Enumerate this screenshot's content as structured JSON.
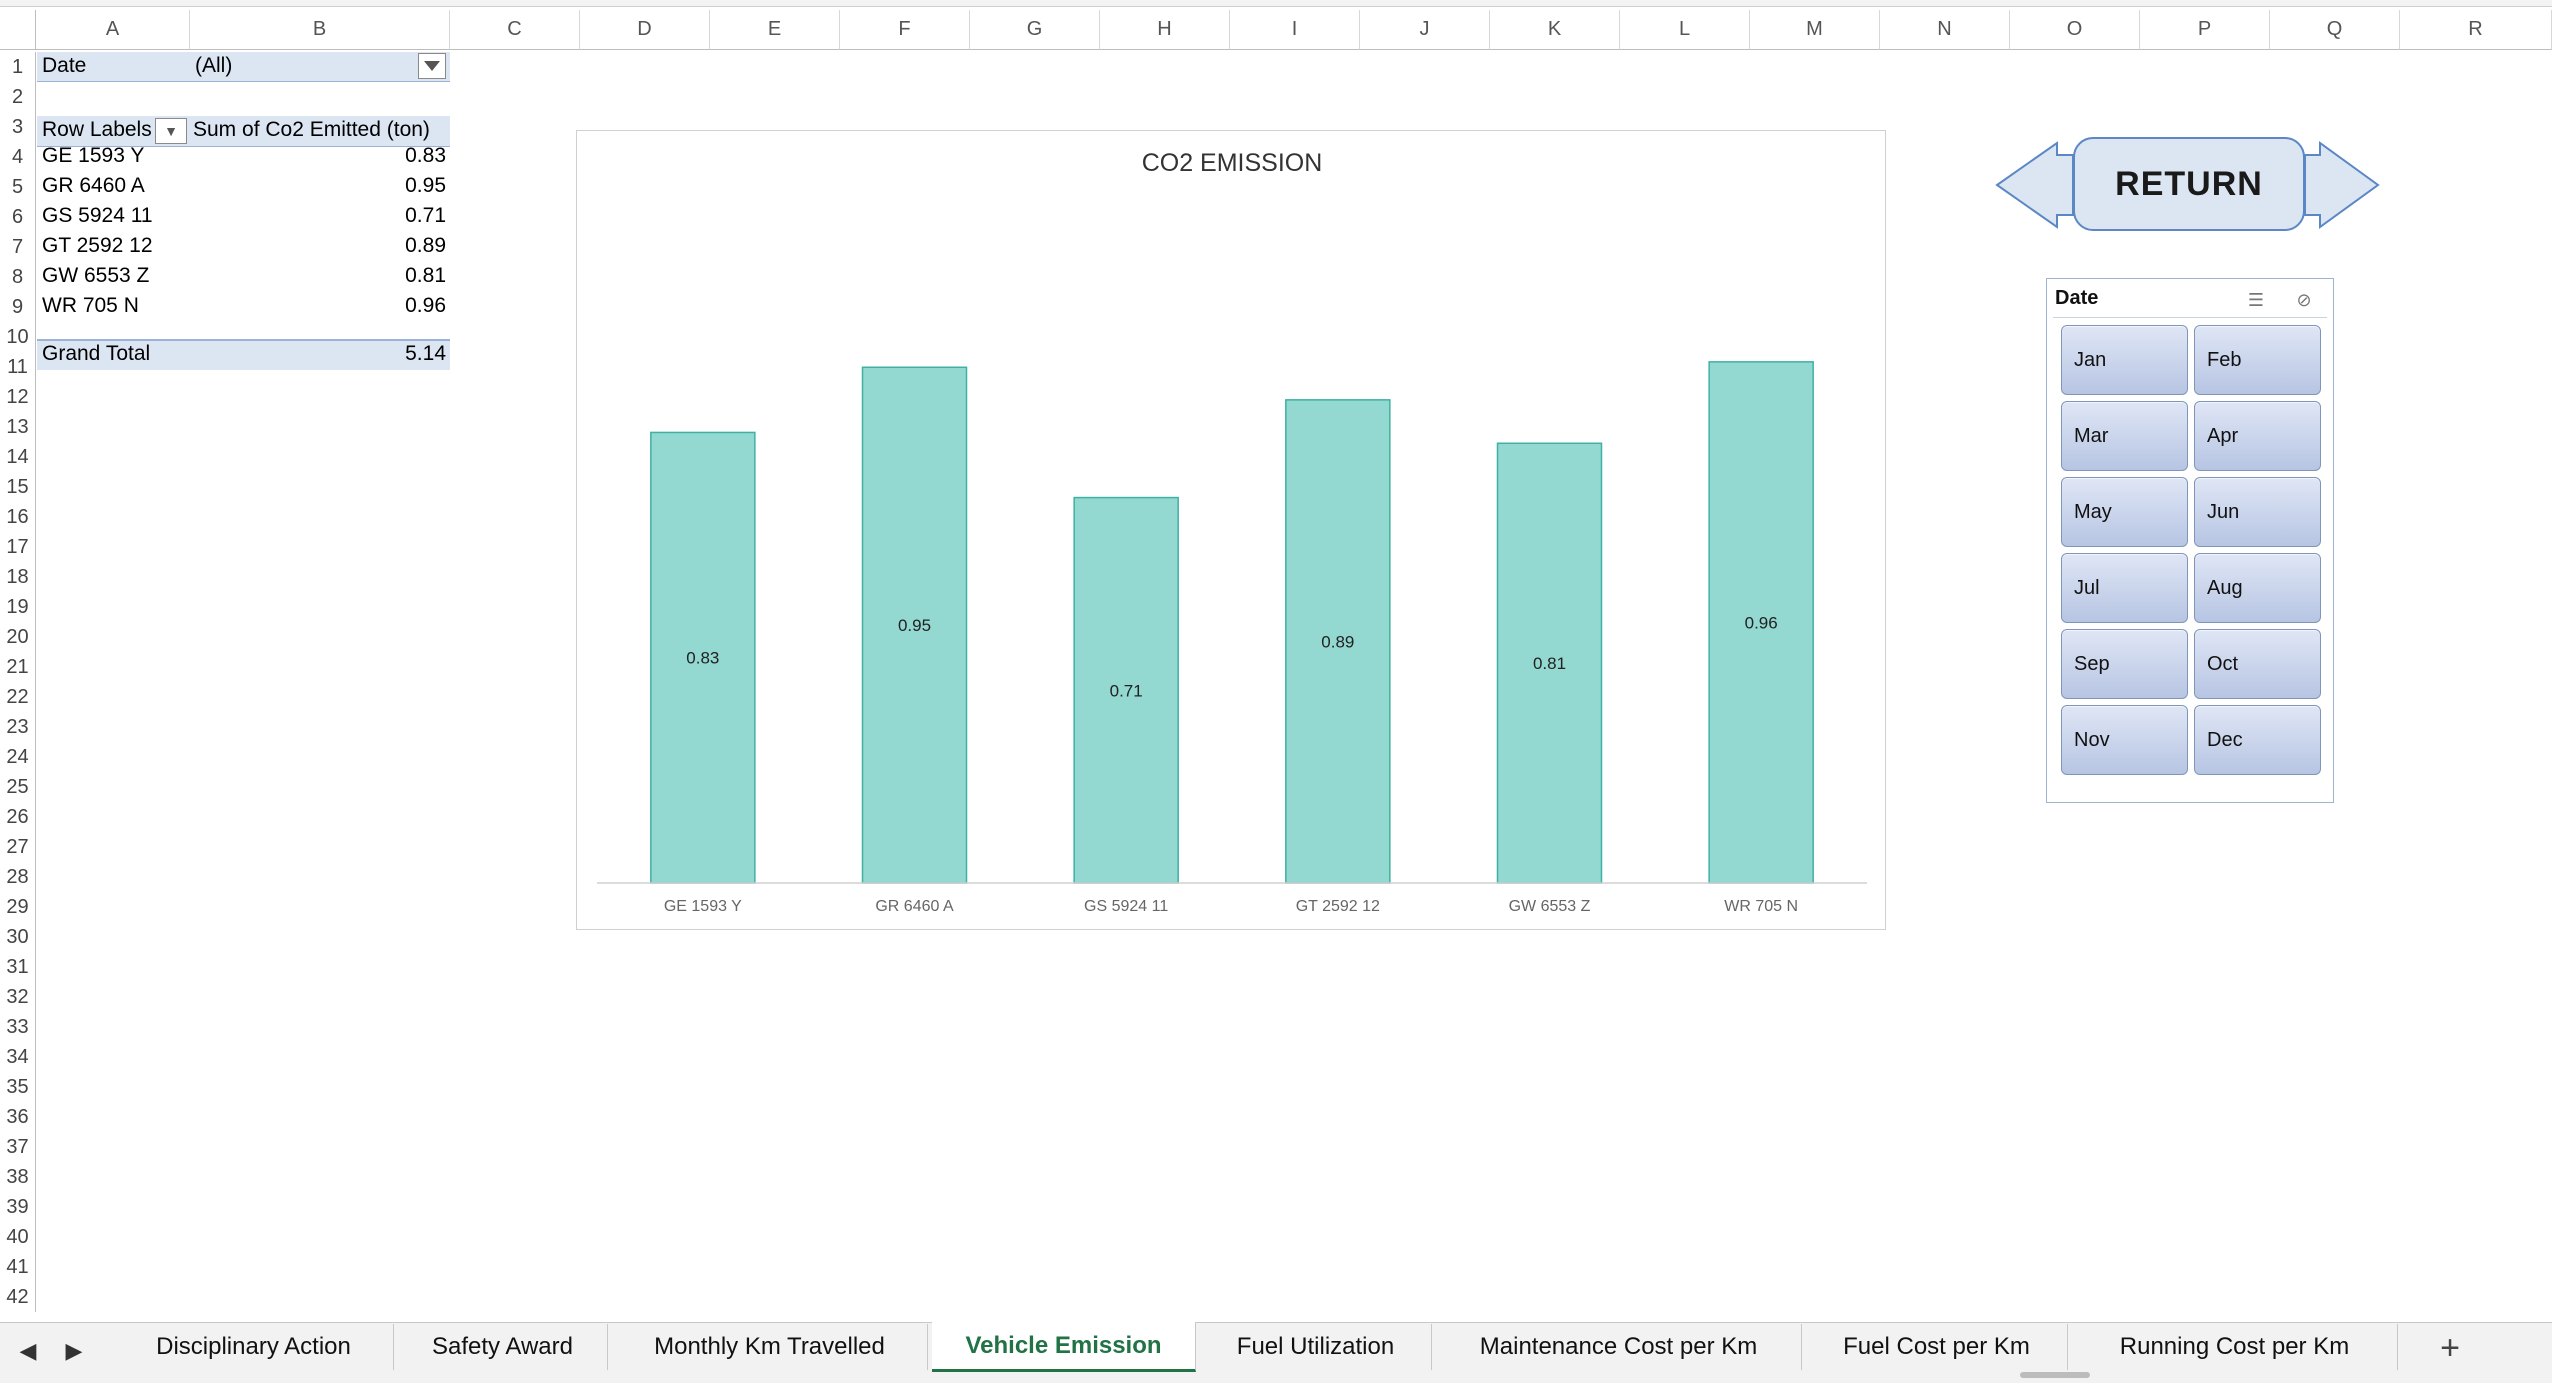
{
  "columns": [
    "A",
    "B",
    "C",
    "D",
    "E",
    "F",
    "G",
    "H",
    "I",
    "J",
    "K",
    "L",
    "M",
    "N",
    "O",
    "P",
    "Q",
    "R"
  ],
  "rows": [
    "1",
    "2",
    "3",
    "4",
    "5",
    "6",
    "7",
    "8",
    "9",
    "10",
    "11",
    "12",
    "13",
    "14",
    "15",
    "16",
    "17",
    "18",
    "19",
    "20",
    "21",
    "22",
    "23",
    "24",
    "25",
    "26",
    "27",
    "28",
    "29",
    "30",
    "31",
    "32",
    "33",
    "34",
    "35",
    "36",
    "37",
    "38",
    "39",
    "40",
    "41",
    "42"
  ],
  "pivot": {
    "filter_label": "Date",
    "filter_value": "(All)",
    "row_labels_header": "Row Labels",
    "sum_header": "Sum of Co2 Emitted (ton)",
    "rows": [
      {
        "label": "GE 1593 Y",
        "value": "0.83"
      },
      {
        "label": "GR 6460 A",
        "value": "0.95"
      },
      {
        "label": "GS 5924 11",
        "value": "0.71"
      },
      {
        "label": "GT 2592 12",
        "value": "0.89"
      },
      {
        "label": "GW 6553 Z",
        "value": "0.81"
      },
      {
        "label": "WR 705 N",
        "value": "0.96"
      }
    ],
    "total_label": "Grand Total",
    "total_value": "5.14"
  },
  "chart_data": {
    "type": "bar",
    "title": "CO2 EMISSION",
    "categories": [
      "GE 1593 Y",
      "GR 6460 A",
      "GS 5924 11",
      "GT 2592 12",
      "GW 6553 Z",
      "WR 705 N"
    ],
    "values": [
      0.83,
      0.95,
      0.71,
      0.89,
      0.81,
      0.96
    ],
    "data_labels": [
      "0.83",
      "0.95",
      "0.71",
      "0.89",
      "0.81",
      "0.96"
    ],
    "ylim": [
      0,
      1.05
    ],
    "grid": false,
    "bar_color": "#93d9d1",
    "bar_stroke": "#3fb0a4"
  },
  "return_button": {
    "label": "RETURN"
  },
  "slicer": {
    "title": "Date",
    "months": [
      "Jan",
      "Feb",
      "Mar",
      "Apr",
      "May",
      "Jun",
      "Jul",
      "Aug",
      "Sep",
      "Oct",
      "Nov",
      "Dec"
    ]
  },
  "sheet_tabs": [
    {
      "label": "Disciplinary Action",
      "active": false
    },
    {
      "label": "Safety Award",
      "active": false
    },
    {
      "label": "Monthly Km Travelled",
      "active": false
    },
    {
      "label": "Vehicle Emission",
      "active": true
    },
    {
      "label": "Fuel Utilization",
      "active": false
    },
    {
      "label": "Maintenance Cost per Km",
      "active": false
    },
    {
      "label": "Fuel Cost per Km",
      "active": false
    },
    {
      "label": "Running Cost per Km",
      "active": false
    }
  ],
  "icons": {
    "tab_prev": "◀",
    "tab_next": "▶",
    "add_sheet": "+",
    "multiselect": "☰",
    "clear_filter": "⊘",
    "pivot_filter": "▼"
  },
  "colors": {
    "accent": "#217346",
    "pivot_fill": "#dce6f2",
    "slicer_button": "#c4d0ea"
  }
}
